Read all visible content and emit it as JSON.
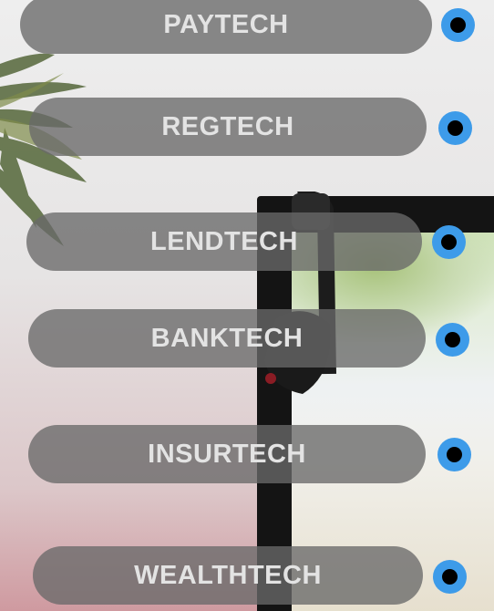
{
  "colors": {
    "pill_background": "#696969",
    "pill_text": "#e3e3e3",
    "radio_accent": "#3d9be9",
    "radio_dot": "#000000"
  },
  "menu": {
    "items": [
      {
        "label": "PAYTECH",
        "selected": true
      },
      {
        "label": "REGTECH",
        "selected": true
      },
      {
        "label": "LENDTECH",
        "selected": true
      },
      {
        "label": "BANKTECH",
        "selected": true
      },
      {
        "label": "INSURTECH",
        "selected": true
      },
      {
        "label": "WEALTHTECH",
        "selected": true
      }
    ]
  }
}
